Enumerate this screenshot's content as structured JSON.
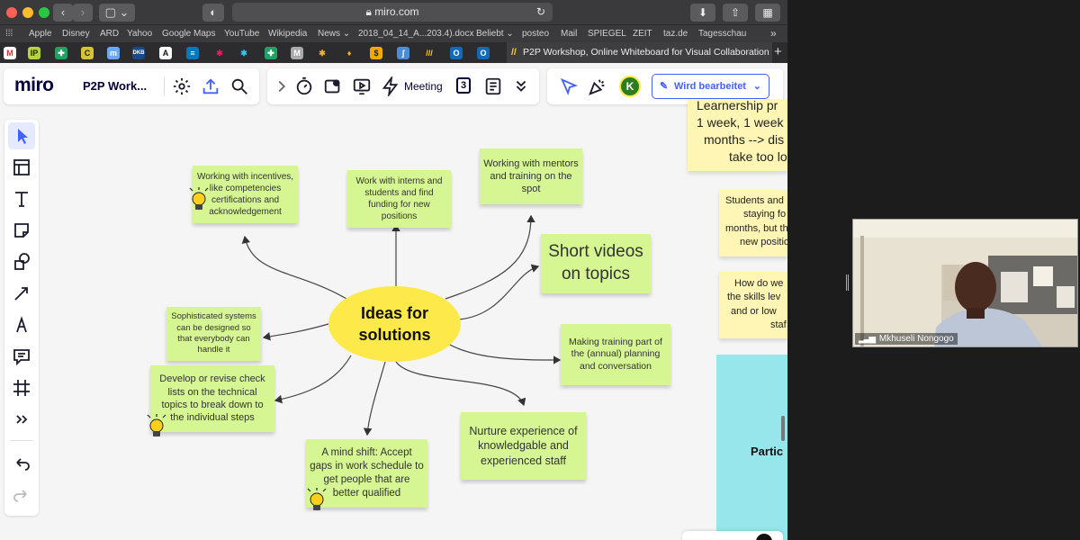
{
  "browser": {
    "url": "miro.com",
    "favorites": [
      "Apple",
      "Disney",
      "ARD",
      "Yahoo",
      "Google Maps",
      "YouTube",
      "Wikipedia",
      "News ⌄",
      "2018_04_14_A...203.4).docx",
      "Beliebt ⌄",
      "posteo",
      "Mail",
      "SPIEGEL",
      "ZEIT",
      "taz.de",
      "Tagesschau"
    ],
    "overflow": "»",
    "active_tab_title": "P2P Workshop, Online Whiteboard for Visual Collaboration",
    "new_tab": "+"
  },
  "miro": {
    "logo": "miro",
    "board_name": "P2P Work...",
    "meeting_label": "Meeting",
    "count_badge": "3",
    "avatar_initial": "K",
    "status_button": "Wird bearbeitet",
    "colors": {
      "accent": "#4262ff",
      "sticky_green": "#d5f692",
      "sticky_yellow": "#fff6b6",
      "oval": "#fee94a",
      "teal_frame": "#97e6ec",
      "avatar": "#2d7d1e"
    }
  },
  "canvas": {
    "center_line1": "Ideas for",
    "center_line2": "solutions",
    "notes": {
      "incentives": "Working with incentives, like competencies certifications and acknowledgement",
      "interns": "Work with interns and students and find funding for new positions",
      "mentors": "Working with mentors and training on the spot",
      "videos": "Short videos on topics",
      "systems": "Sophisticated systems can be designed so that everybody can handle it",
      "annual": "Making training part of the (annual) planning and conversation",
      "checklists": "Develop or revise check lists on the technical topics to break down to the individual steps",
      "nurture": "Nurture experience of knowledgable and experienced staff",
      "mindshift": "A mind shift: Accept gaps in work schedule to get people that are better qualified"
    },
    "right_notes": {
      "top_lines": [
        "Learnership pr",
        "1 week, 1 week",
        "months --> dis",
        "take too lo"
      ],
      "middle_lines": [
        "Students and",
        "staying fo",
        "months, but th",
        "new position"
      ],
      "bottom_lines": [
        "How do we",
        "the skills lev",
        "and or low",
        "staf"
      ],
      "teal_text": "Partic"
    }
  },
  "video": {
    "participant_name": "Mkhuseli Nongogo"
  }
}
